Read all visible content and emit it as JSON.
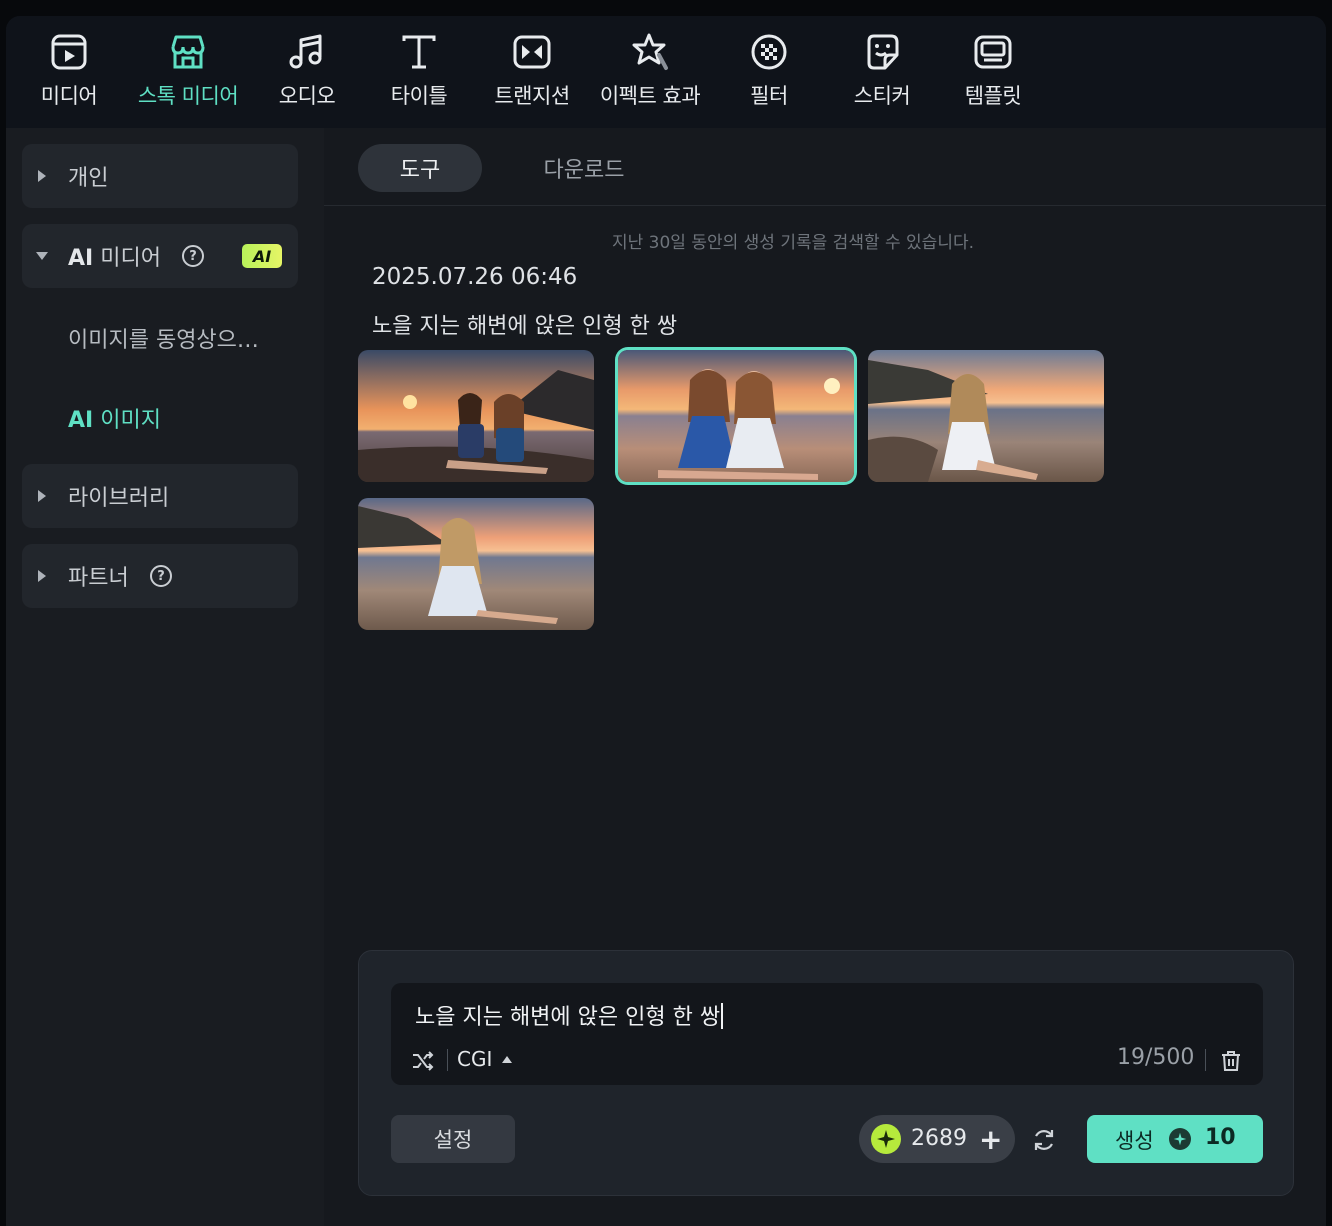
{
  "toolbar": {
    "items": [
      {
        "label": "미디어",
        "icon": "media-icon"
      },
      {
        "label": "스톡 미디어",
        "icon": "stock-media-icon",
        "active": true
      },
      {
        "label": "오디오",
        "icon": "music-note-icon"
      },
      {
        "label": "타이틀",
        "icon": "title-t-icon"
      },
      {
        "label": "트랜지션",
        "icon": "transition-icon"
      },
      {
        "label": "이펙트 효과",
        "icon": "effects-star-icon"
      },
      {
        "label": "필터",
        "icon": "filter-icon"
      },
      {
        "label": "스티커",
        "icon": "sticker-icon"
      },
      {
        "label": "템플릿",
        "icon": "template-icon"
      }
    ]
  },
  "sidebar": {
    "personal": "개인",
    "ai_media_prefix": "AI",
    "ai_media_suffix": " 미디어",
    "ai_badge": "AI",
    "image_to_video": "이미지를 동영상으…",
    "ai_image_prefix": "AI",
    "ai_image_suffix": " 이미지",
    "library": "라이브러리",
    "partner": "파트너",
    "help_glyph": "?"
  },
  "tabs": {
    "tools": "도구",
    "downloads": "다운로드"
  },
  "history": {
    "hint": "지난 30일 동안의 생성 기록을 검색할 수 있습니다.",
    "date": "2025.07.26 06:46",
    "prompt": "노을 지는 해변에 앉은 인형 한 쌍",
    "selected_index": 1,
    "thumbnail_count": 4
  },
  "prompt_panel": {
    "input_value": "노을 지는 해변에 앉은 인형 한 쌍",
    "style": "CGI",
    "char_count": "19/500",
    "settings_label": "설정",
    "credits": "2689",
    "generate_label": "생성",
    "generate_cost": "10"
  },
  "colors": {
    "accent": "#5fe0c4",
    "credit_coin": "#b6ea3c"
  }
}
